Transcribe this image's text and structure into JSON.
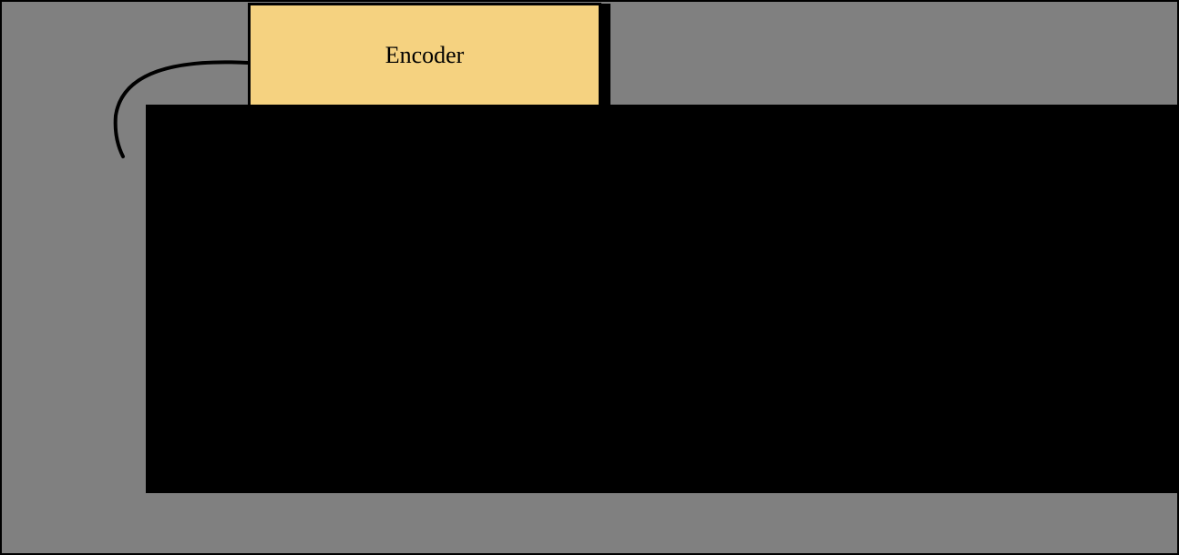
{
  "diagram": {
    "encoder_label": "Encoder"
  }
}
